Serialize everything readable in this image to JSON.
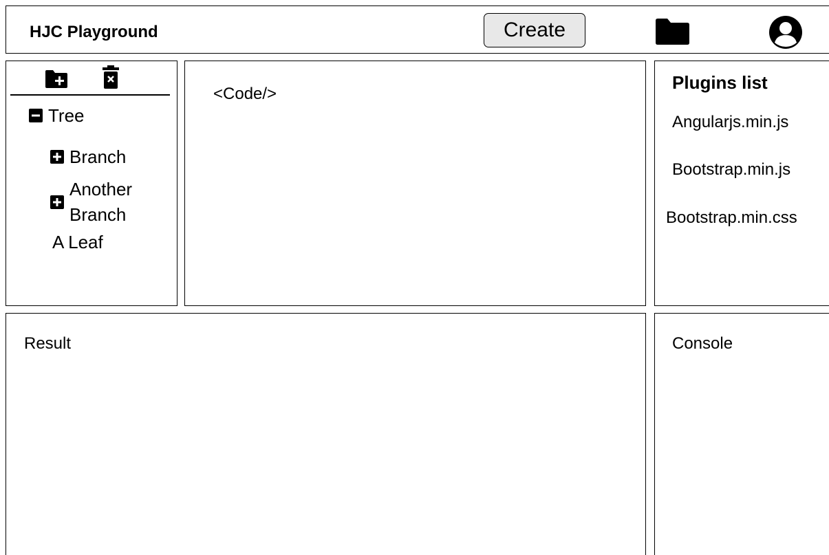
{
  "header": {
    "app_title": "HJC Playground",
    "create_label": "Create",
    "folder_icon": "folder-icon",
    "user_icon": "account-circle-icon"
  },
  "tree": {
    "toolbar": {
      "add_icon": "folder-plus-icon",
      "delete_icon": "trash-x-icon"
    },
    "root": {
      "label": "Tree",
      "state": "expanded"
    },
    "children": [
      {
        "label": "Branch",
        "state": "collapsed"
      },
      {
        "label": "Another Branch",
        "state": "collapsed"
      },
      {
        "label": "A Leaf",
        "state": "leaf"
      }
    ]
  },
  "code": {
    "placeholder": "<Code/>"
  },
  "plugins": {
    "title": "Plugins list",
    "items": [
      "Angularjs.min.js",
      "Bootstrap.min.js",
      "Bootstrap.min.css"
    ]
  },
  "result": {
    "label": "Result"
  },
  "console": {
    "label": "Console"
  }
}
